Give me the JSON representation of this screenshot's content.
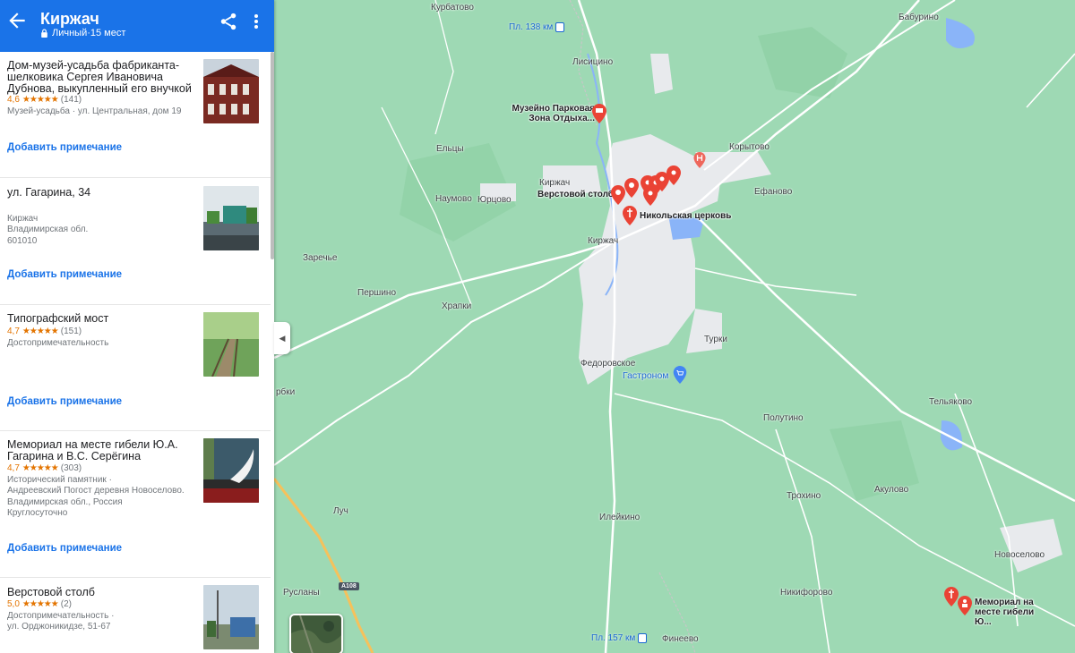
{
  "header": {
    "title": "Киржач",
    "subtitle": "Личный·15 мест"
  },
  "places": [
    {
      "title": "Дом-музей-усадьба фабриканта-шелковика Сергея Ивановича Дубнова, выкупленный его внучкой",
      "rating": "4,6",
      "stars": "★★★★★",
      "reviews": "(141)",
      "meta": [
        "Музей-усадьба · ул. Центральная, дом 19"
      ],
      "add_note": "Добавить примечание"
    },
    {
      "title": "ул. Гагарина, 34",
      "meta": [
        "Киржач",
        "Владимирская обл.",
        "601010"
      ],
      "add_note": "Добавить примечание"
    },
    {
      "title": "Типографский мост",
      "rating": "4,7",
      "stars": "★★★★★",
      "reviews": "(151)",
      "meta": [
        "Достопримечательность"
      ],
      "add_note": "Добавить примечание"
    },
    {
      "title": "Мемориал на месте гибели Ю.А. Гагарина и В.С. Серёгина",
      "rating": "4,7",
      "stars": "★★★★★",
      "reviews": "(303)",
      "meta": [
        "Исторический памятник ·",
        "Андреевский Погост деревня Новоселово.",
        "Владимирская обл., Россия",
        "Круглосуточно"
      ],
      "add_note": "Добавить примечание"
    },
    {
      "title": "Верстовой столб",
      "rating": "5,0",
      "stars": "★★★★★",
      "reviews": "(2)",
      "meta": [
        "Достопримечательность ·",
        "ул. Орджоникидзе, 51-67"
      ]
    }
  ],
  "map": {
    "villages": {
      "kurbatovo": "Курбатово",
      "babyrino": "Бабурино",
      "lisitsino": "Лисицино",
      "eltsy": "Ельцы",
      "naumovo": "Наумово",
      "yurtsovo": "Юрцово",
      "korytovo": "Корытово",
      "efanovo": "Ефаново",
      "kirzhach_small": "Киржач",
      "kirzhach": "Киржач",
      "zarechye": "Заречье",
      "pershino": "Першино",
      "hrapki": "Храпки",
      "turki": "Турки",
      "fedorovskoe": "Федоровское",
      "polutino": "Полутино",
      "telyakovo": "Тельяково",
      "trohino": "Трохино",
      "akulovo": "Акулово",
      "ilejkino": "Илейкино",
      "luch": "Луч",
      "novoselovo": "Новоселово",
      "ruslany": "Русланы",
      "nikiforovo": "Никифорово",
      "fineevo": "Финеево",
      "ryabki": "рбки"
    },
    "stations": {
      "pl138": "Пл. 138 км",
      "pl157": "Пл. 157 км"
    },
    "poi": {
      "park_zone": "Музейно Парковая Зона Отдыха...",
      "verst_pole": "Верстовой столб",
      "nikolskaya": "Никольская церковь",
      "gastronom": "Гастроном",
      "memorial": "Мемориал на месте гибели Ю..."
    },
    "road_sign": "A108",
    "colors": {
      "land": "#9ed9b4",
      "town": "#e8eaed",
      "water": "#8ab4f8",
      "road": "#ffffff",
      "highway": "#f6c15b",
      "pin": "#ea4335",
      "header": "#1a73e8"
    }
  }
}
